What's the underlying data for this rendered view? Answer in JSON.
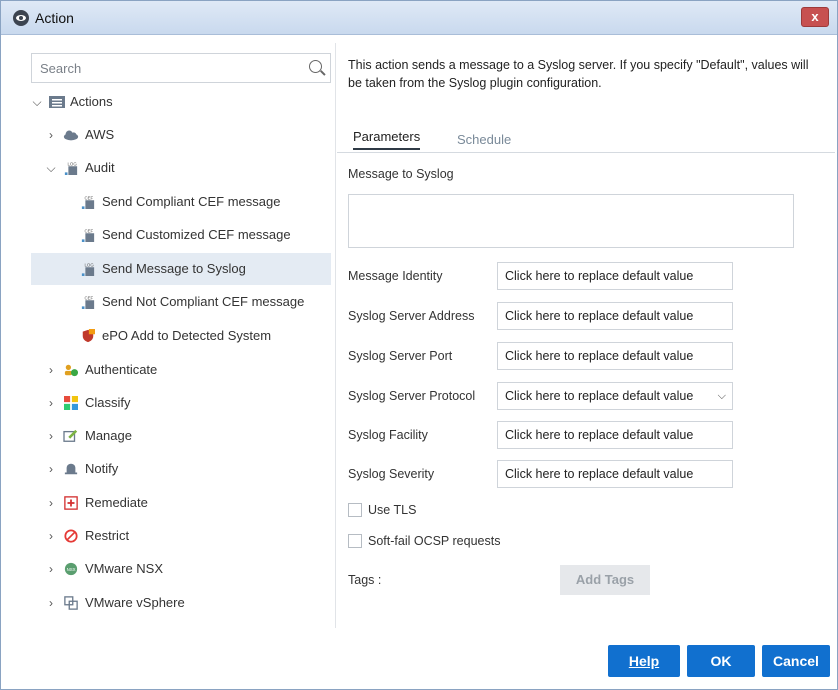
{
  "window": {
    "title": "Action",
    "close_label": "x"
  },
  "search": {
    "placeholder": "Search"
  },
  "tree": {
    "root": "Actions",
    "aws": "AWS",
    "audit": "Audit",
    "audit_items": [
      "Send Compliant CEF message",
      "Send Customized CEF message",
      "Send Message to Syslog",
      "Send Not Compliant CEF message",
      "ePO Add to Detected System"
    ],
    "categories": [
      "Authenticate",
      "Classify",
      "Manage",
      "Notify",
      "Remediate",
      "Restrict",
      "VMware NSX",
      "VMware vSphere"
    ]
  },
  "description": "This action sends a message to a Syslog server. If you specify \"Default\", values will be taken from the Syslog plugin configuration.",
  "tabs": {
    "parameters": "Parameters",
    "schedule": "Schedule"
  },
  "form": {
    "message_label": "Message to Syslog",
    "message_value": "",
    "fields": [
      {
        "label": "Message Identity",
        "value": "Click here to replace default value"
      },
      {
        "label": "Syslog Server Address",
        "value": "Click here to replace default value"
      },
      {
        "label": "Syslog Server Port",
        "value": "Click here to replace default value"
      },
      {
        "label": "Syslog Server Protocol",
        "value": "Click here to replace default value"
      },
      {
        "label": "Syslog Facility",
        "value": "Click here to replace default value"
      },
      {
        "label": "Syslog Severity",
        "value": "Click here to replace default value"
      }
    ],
    "use_tls": "Use TLS",
    "soft_fail": "Soft-fail OCSP requests",
    "tags_label": "Tags :",
    "add_tags": "Add Tags"
  },
  "buttons": {
    "help": "Help",
    "ok": "OK",
    "cancel": "Cancel"
  },
  "colors": {
    "primary": "#1170cf",
    "selected_row": "#e4ebf3"
  }
}
